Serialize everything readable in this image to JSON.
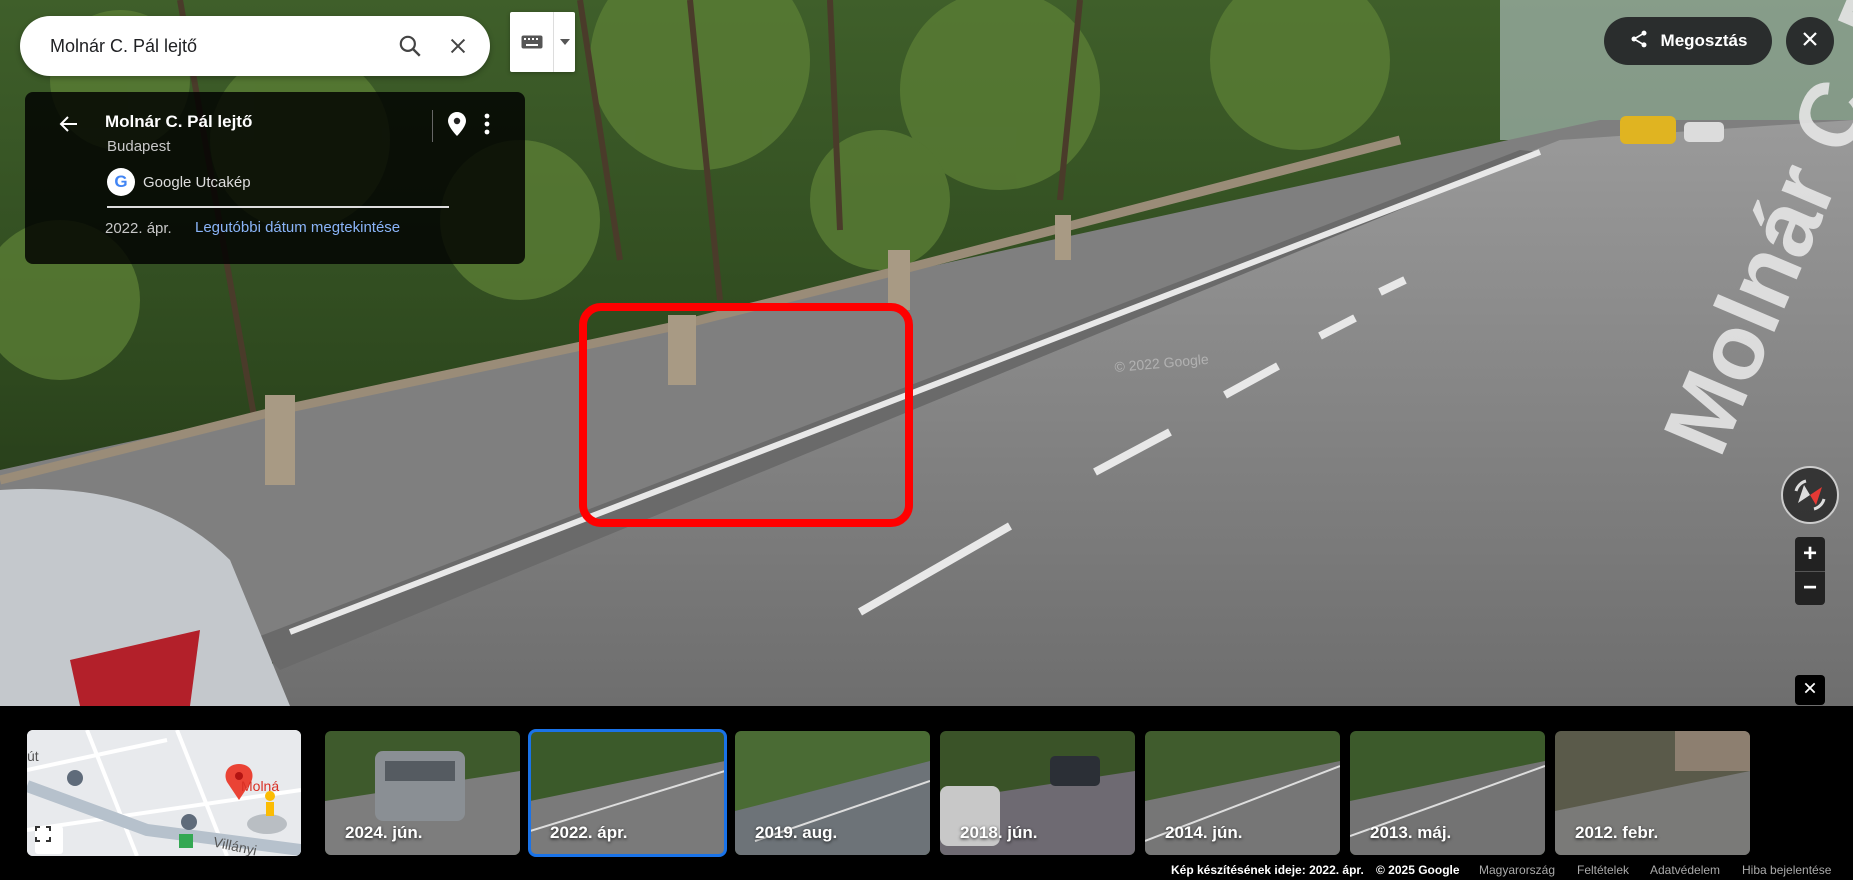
{
  "search": {
    "value": "Molnár C. Pál lejtő"
  },
  "icons": {
    "search": "search-icon",
    "clear": "close-icon",
    "keyboard": "keyboard-icon",
    "dropdown": "chevron-down-icon",
    "back": "arrow-back-icon",
    "pin": "location-pin-icon",
    "more": "more-vertical-icon",
    "share": "share-icon",
    "compass": "compass-icon",
    "expand": "fullscreen-icon"
  },
  "card": {
    "title": "Molnár C. Pál lejtő",
    "city": "Budapest",
    "provider_logo": "G",
    "provider": "Google Utcakép",
    "date": "2022. ápr.",
    "latest_link": "Legutóbbi dátum megtekintése"
  },
  "topright": {
    "share_label": "Megosztás"
  },
  "zoom": {
    "in": "+",
    "out": "−"
  },
  "scene": {
    "road_label": "Molnár C. Pál lejtő",
    "watermark": "© 2022 Google"
  },
  "minimap": {
    "label_left": "út",
    "label_place": "Molná",
    "label_road": "Villányi"
  },
  "timeline": [
    {
      "label": "2024. jún.",
      "active": false
    },
    {
      "label": "2022. ápr.",
      "active": true
    },
    {
      "label": "2019. aug.",
      "active": false
    },
    {
      "label": "2018. jún.",
      "active": false
    },
    {
      "label": "2014. jún.",
      "active": false
    },
    {
      "label": "2013. máj.",
      "active": false
    },
    {
      "label": "2012. febr.",
      "active": false
    }
  ],
  "footer": {
    "capture": "Kép készítésének ideje: 2022. ápr.",
    "copyright": "© 2025 Google",
    "country": "Magyarország",
    "terms": "Feltételek",
    "privacy": "Adatvédelem",
    "report": "Hiba bejelentése"
  },
  "colors": {
    "accent": "#1a73e8",
    "link": "#8ab4f8",
    "highlight": "#ff0000"
  }
}
